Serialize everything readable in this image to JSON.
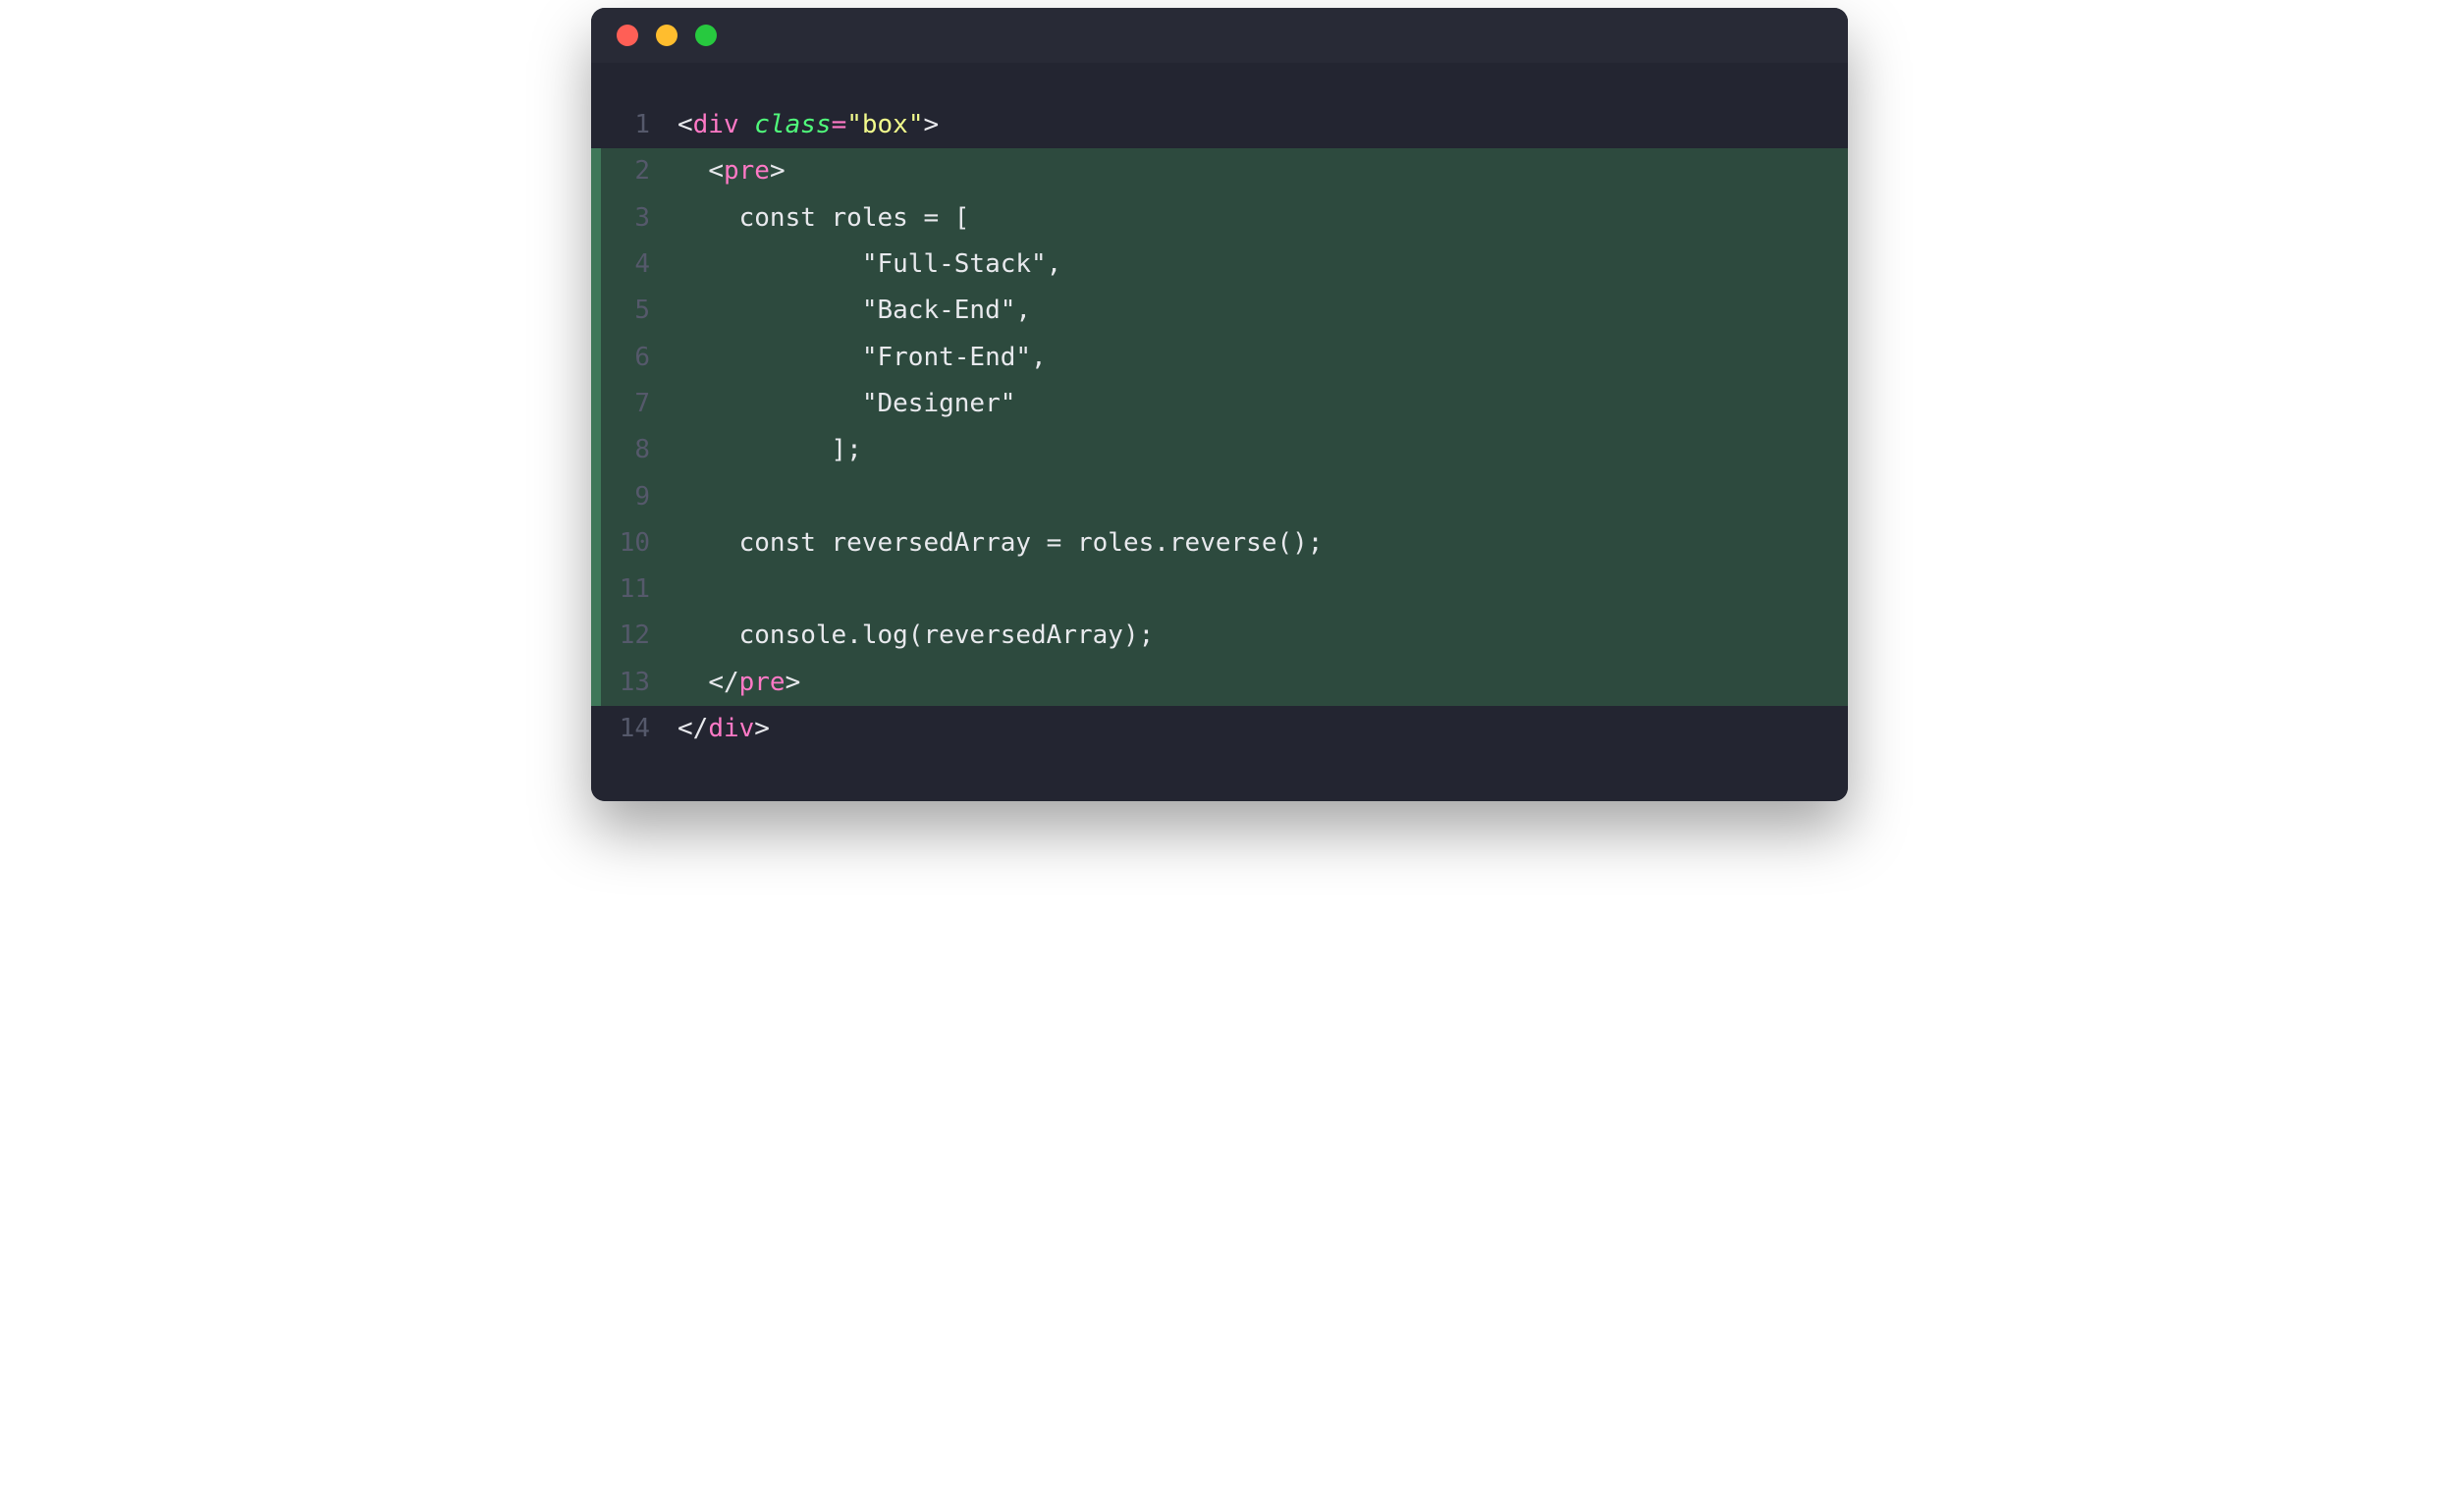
{
  "window": {
    "traffic": [
      "close",
      "minimize",
      "maximize"
    ]
  },
  "colors": {
    "background_window": "#282a36",
    "background_editor": "#232531",
    "highlight_row": "#2d4a3e",
    "highlight_edge": "#3f7759",
    "gutter": "#55596b",
    "text": "#e8e9ed",
    "tag": "#ff79c6",
    "attr": "#50fa7b",
    "string": "#f1fa8c"
  },
  "editor": {
    "lines": [
      {
        "num": "1",
        "highlighted": false,
        "tokens": [
          {
            "t": "<",
            "c": "punct"
          },
          {
            "t": "div",
            "c": "tag"
          },
          {
            "t": " ",
            "c": "text"
          },
          {
            "t": "class",
            "c": "attr"
          },
          {
            "t": "=",
            "c": "eq"
          },
          {
            "t": "\"box\"",
            "c": "string"
          },
          {
            "t": ">",
            "c": "punct"
          }
        ]
      },
      {
        "num": "2",
        "highlighted": true,
        "tokens": [
          {
            "t": "  ",
            "c": "text"
          },
          {
            "t": "<",
            "c": "punct"
          },
          {
            "t": "pre",
            "c": "tag"
          },
          {
            "t": ">",
            "c": "punct"
          }
        ]
      },
      {
        "num": "3",
        "highlighted": true,
        "tokens": [
          {
            "t": "    const roles = [",
            "c": "text"
          }
        ]
      },
      {
        "num": "4",
        "highlighted": true,
        "tokens": [
          {
            "t": "            \"Full-Stack\",",
            "c": "text"
          }
        ]
      },
      {
        "num": "5",
        "highlighted": true,
        "tokens": [
          {
            "t": "            \"Back-End\",",
            "c": "text"
          }
        ]
      },
      {
        "num": "6",
        "highlighted": true,
        "tokens": [
          {
            "t": "            \"Front-End\",",
            "c": "text"
          }
        ]
      },
      {
        "num": "7",
        "highlighted": true,
        "tokens": [
          {
            "t": "            \"Designer\"",
            "c": "text"
          }
        ]
      },
      {
        "num": "8",
        "highlighted": true,
        "tokens": [
          {
            "t": "          ];",
            "c": "text"
          }
        ]
      },
      {
        "num": "9",
        "highlighted": true,
        "tokens": [
          {
            "t": "",
            "c": "text"
          }
        ]
      },
      {
        "num": "10",
        "highlighted": true,
        "tokens": [
          {
            "t": "    const reversedArray = roles.reverse();",
            "c": "text"
          }
        ]
      },
      {
        "num": "11",
        "highlighted": true,
        "tokens": [
          {
            "t": "",
            "c": "text"
          }
        ]
      },
      {
        "num": "12",
        "highlighted": true,
        "tokens": [
          {
            "t": "    console.log(reversedArray);",
            "c": "text"
          }
        ]
      },
      {
        "num": "13",
        "highlighted": true,
        "tokens": [
          {
            "t": "  ",
            "c": "text"
          },
          {
            "t": "</",
            "c": "punct"
          },
          {
            "t": "pre",
            "c": "tag"
          },
          {
            "t": ">",
            "c": "punct"
          }
        ]
      },
      {
        "num": "14",
        "highlighted": false,
        "tokens": [
          {
            "t": "</",
            "c": "punct"
          },
          {
            "t": "div",
            "c": "tag"
          },
          {
            "t": ">",
            "c": "punct"
          }
        ]
      }
    ]
  }
}
